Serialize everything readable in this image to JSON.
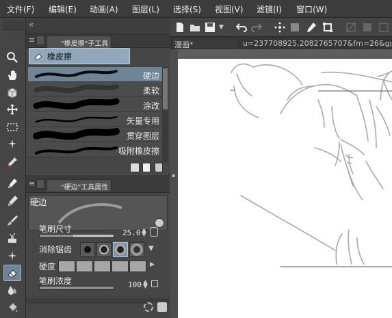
{
  "menu": [
    "文件(F)",
    "编辑(E)",
    "动画(A)",
    "图层(L)",
    "选择(S)",
    "视图(V)",
    "滤镜(I)",
    "窗口(W)"
  ],
  "subtool_panel": {
    "tab_label": "\"橡皮擦\"子工具",
    "group_label": "橡皮擦",
    "brushes": [
      {
        "label": "硬边"
      },
      {
        "label": "柔软"
      },
      {
        "label": "涂改"
      },
      {
        "label": "矢量专用"
      },
      {
        "label": "贯穿图层"
      },
      {
        "label": "吸附橡皮擦"
      }
    ],
    "selected_brush": "硬边"
  },
  "tool_property": {
    "tab_label": "\"硬边\"工具属性",
    "preview_label": "硬边",
    "brush_size_label": "笔刷尺寸",
    "brush_size_value": "25.0",
    "brush_size_fraction": 0.45,
    "antialias_label": "消除锯齿",
    "hardness_label": "硬度",
    "density_label": "笔刷浓度",
    "density_value": "100",
    "density_fraction": 1.0
  },
  "document": {
    "tab_title": "漫画*",
    "file_name": "u=237708925,2082765707&fm=26&gp=0.j"
  },
  "colors": {
    "selection_blue": "#6e8596",
    "canvas": "#ffffff",
    "panel": "#464646"
  },
  "tools": [
    "zoom-icon",
    "hand-icon",
    "object-icon",
    "move-icon",
    "marquee-icon",
    "magic-wand-icon",
    "eyedropper-icon",
    "pen-icon",
    "pencil-icon",
    "brush-icon",
    "airbrush-icon",
    "sparkle-icon",
    "eraser-icon",
    "blend-icon",
    "fill-icon"
  ]
}
